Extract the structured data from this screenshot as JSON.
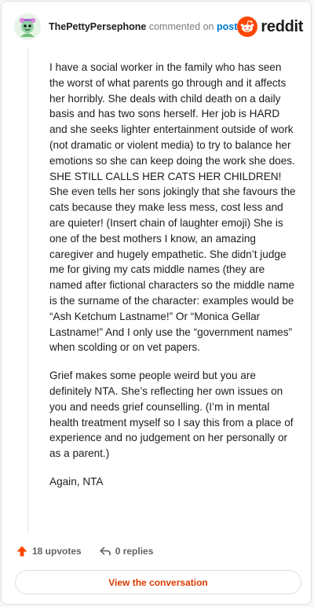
{
  "header": {
    "username": "ThePettyPersephone",
    "commented_text": "commented on",
    "post_link": "post",
    "brand": "reddit",
    "avatar_icon": "snoo-avatar-icon",
    "brand_icon": "reddit-logo-icon",
    "brand_color": "#ff4500"
  },
  "comment": {
    "paragraphs": [
      "I have a social worker in the family who has seen the worst of what parents go through and it affects her horribly. She deals with child death on a daily basis and has two sons herself. Her job is HARD and she seeks lighter entertainment outside of work (not dramatic or violent media) to try to balance her emotions so she can keep doing the work she does. SHE STILL CALLS HER CATS HER CHILDREN! She even tells her sons jokingly that she favours the cats because they make less mess, cost less and are quieter! (Insert chain of laughter emoji) She is one of the best mothers I know, an amazing caregiver and hugely empathetic. She didn’t judge me for giving my cats middle names (they are named after fictional characters so the middle name is the surname of the character: examples would be “Ash Ketchum Lastname!” Or “Monica Gellar Lastname!” And I only use the “government names” when scolding or on vet papers.",
      "Grief makes some people weird but you are definitely NTA. She’s reflecting her own issues on you and needs grief counselling. (I’m in mental health treatment myself so I say this from a place of experience and no judgement on her personally or as a parent.)",
      "Again, NTA"
    ]
  },
  "actions": {
    "upvotes": "18 upvotes",
    "replies": "0 replies",
    "upvote_icon": "upvote-arrow-icon",
    "reply_icon": "reply-arrow-icon",
    "upvote_color": "#ff4500"
  },
  "cta": {
    "label": "View the conversation",
    "color": "#d93a00"
  }
}
